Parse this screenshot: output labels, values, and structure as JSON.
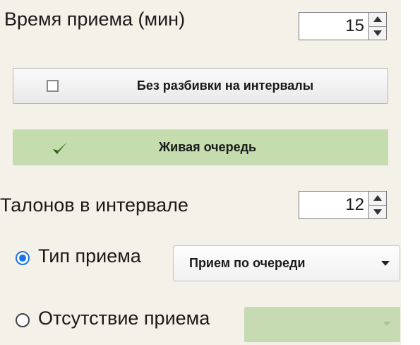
{
  "reception_time": {
    "label": "Время приема (мин)",
    "value": "15"
  },
  "no_intervals_button": {
    "label": "Без разбивки на интервалы",
    "checked": false
  },
  "live_queue_button": {
    "label": "Живая очередь",
    "checked": true,
    "color": "#c4dcae"
  },
  "tickets_per_interval": {
    "label": "Талонов в интервале",
    "value": "12"
  },
  "reception_type": {
    "label": "Тип приема",
    "selected": true,
    "dropdown_value": "Прием по очереди",
    "accent": "#1a73e8"
  },
  "no_reception": {
    "label": "Отсутствие приема",
    "selected": false,
    "dropdown_value": ""
  }
}
